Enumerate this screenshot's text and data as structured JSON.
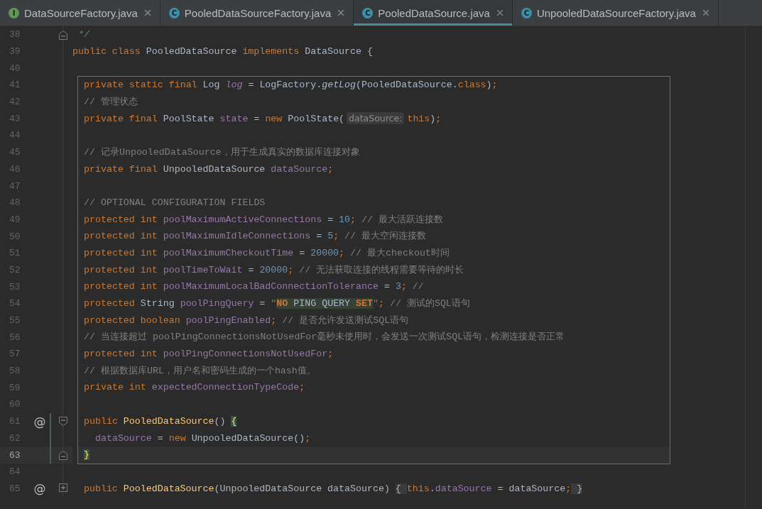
{
  "tabs": [
    {
      "label": "DataSourceFactory.java",
      "icon_letter": "I",
      "color": "#629755",
      "selected": false
    },
    {
      "label": "PooledDataSourceFactory.java",
      "icon_letter": "C",
      "color": "#3d8ea8",
      "selected": false
    },
    {
      "label": "PooledDataSource.java",
      "icon_letter": "C",
      "color": "#3d8ea8",
      "selected": true
    },
    {
      "label": "UnpooledDataSourceFactory.java",
      "icon_letter": "C",
      "color": "#3d8ea8",
      "selected": false
    }
  ],
  "editor": {
    "lines": [
      {
        "number": "38",
        "fold": {
          "kind": "end"
        },
        "boxed": false,
        "current": false,
        "changed": false,
        "tokens": [
          {
            "t": " */",
            "kind": "doc"
          }
        ]
      },
      {
        "number": "39",
        "boxed": false,
        "current": false,
        "changed": false,
        "tokens": [
          {
            "t": "public class ",
            "kind": "kw"
          },
          {
            "t": "PooledDataSource ",
            "kind": "plain"
          },
          {
            "t": "implements ",
            "kind": "kw"
          },
          {
            "t": "DataSource {",
            "kind": "plain"
          }
        ]
      },
      {
        "number": "40",
        "boxed": false,
        "current": false,
        "changed": false
      },
      {
        "number": "41",
        "boxed": true,
        "current": false,
        "changed": false,
        "tokens": [
          {
            "t": "private static final ",
            "kind": "kw"
          },
          {
            "t": "Log ",
            "kind": "plain"
          },
          {
            "t": "log",
            "kind": "static"
          },
          {
            "t": " = LogFactory.",
            "kind": "plain"
          },
          {
            "t": "getLog",
            "kind": "call"
          },
          {
            "t": "(PooledDataSource.",
            "kind": "plain"
          },
          {
            "t": "class",
            "kind": "kw"
          },
          {
            "t": ")",
            "kind": "plain"
          },
          {
            "t": ";",
            "kind": "kw"
          }
        ]
      },
      {
        "number": "42",
        "boxed": true,
        "current": false,
        "changed": false,
        "tokens": [
          {
            "t": "// 管理状态",
            "kind": "comment"
          }
        ]
      },
      {
        "number": "43",
        "boxed": true,
        "current": false,
        "changed": false,
        "tokens": [
          {
            "t": "private final ",
            "kind": "kw"
          },
          {
            "t": "PoolState ",
            "kind": "plain"
          },
          {
            "t": "state",
            "kind": "field"
          },
          {
            "t": " = ",
            "kind": "plain"
          },
          {
            "t": "new ",
            "kind": "kw"
          },
          {
            "t": "PoolState(",
            "kind": "plain"
          },
          {
            "t": "dataSource:",
            "kind": "hint"
          },
          {
            "t": "this",
            "kind": "kw"
          },
          {
            "t": ")",
            "kind": "plain"
          },
          {
            "t": ";",
            "kind": "kw"
          }
        ]
      },
      {
        "number": "44",
        "boxed": true,
        "current": false,
        "changed": false
      },
      {
        "number": "45",
        "boxed": true,
        "current": false,
        "changed": false,
        "tokens": [
          {
            "t": "// 记录UnpooledDataSource，用于生成真实的数据库连接对象",
            "kind": "comment"
          }
        ]
      },
      {
        "number": "46",
        "boxed": true,
        "current": false,
        "changed": false,
        "tokens": [
          {
            "t": "private final ",
            "kind": "kw"
          },
          {
            "t": "UnpooledDataSource ",
            "kind": "plain"
          },
          {
            "t": "dataSource",
            "kind": "field"
          },
          {
            "t": ";",
            "kind": "kw"
          }
        ]
      },
      {
        "number": "47",
        "boxed": true,
        "current": false,
        "changed": false
      },
      {
        "number": "48",
        "boxed": true,
        "current": false,
        "changed": false,
        "tokens": [
          {
            "t": "// OPTIONAL CONFIGURATION FIELDS",
            "kind": "comment"
          }
        ]
      },
      {
        "number": "49",
        "boxed": true,
        "current": false,
        "changed": false,
        "tokens": [
          {
            "t": "protected int ",
            "kind": "kw"
          },
          {
            "t": "poolMaximumActiveConnections",
            "kind": "field"
          },
          {
            "t": " = ",
            "kind": "plain"
          },
          {
            "t": "10",
            "kind": "num"
          },
          {
            "t": ";",
            "kind": "kw"
          },
          {
            "t": " // 最大活跃连接数",
            "kind": "comment"
          }
        ]
      },
      {
        "number": "50",
        "boxed": true,
        "current": false,
        "changed": false,
        "tokens": [
          {
            "t": "protected int ",
            "kind": "kw"
          },
          {
            "t": "poolMaximumIdleConnections",
            "kind": "field"
          },
          {
            "t": " = ",
            "kind": "plain"
          },
          {
            "t": "5",
            "kind": "num"
          },
          {
            "t": ";",
            "kind": "kw"
          },
          {
            "t": " // 最大空闲连接数",
            "kind": "comment"
          }
        ]
      },
      {
        "number": "51",
        "boxed": true,
        "current": false,
        "changed": false,
        "tokens": [
          {
            "t": "protected int ",
            "kind": "kw"
          },
          {
            "t": "poolMaximumCheckoutTime",
            "kind": "field"
          },
          {
            "t": " = ",
            "kind": "plain"
          },
          {
            "t": "20000",
            "kind": "num"
          },
          {
            "t": ";",
            "kind": "kw"
          },
          {
            "t": " // 最大checkout时间",
            "kind": "comment"
          }
        ]
      },
      {
        "number": "52",
        "boxed": true,
        "current": false,
        "changed": false,
        "tokens": [
          {
            "t": "protected int ",
            "kind": "kw"
          },
          {
            "t": "poolTimeToWait",
            "kind": "field"
          },
          {
            "t": " = ",
            "kind": "plain"
          },
          {
            "t": "20000",
            "kind": "num"
          },
          {
            "t": ";",
            "kind": "kw"
          },
          {
            "t": " // 无法获取连接的线程需要等待的时长",
            "kind": "comment"
          }
        ]
      },
      {
        "number": "53",
        "boxed": true,
        "current": false,
        "changed": false,
        "tokens": [
          {
            "t": "protected int ",
            "kind": "kw"
          },
          {
            "t": "poolMaximumLocalBadConnectionTolerance",
            "kind": "field"
          },
          {
            "t": " = ",
            "kind": "plain"
          },
          {
            "t": "3",
            "kind": "num"
          },
          {
            "t": ";",
            "kind": "kw"
          },
          {
            "t": " //",
            "kind": "comment"
          }
        ]
      },
      {
        "number": "54",
        "boxed": true,
        "current": false,
        "changed": false,
        "tokens": [
          {
            "t": "protected ",
            "kind": "kw"
          },
          {
            "t": "String ",
            "kind": "plain"
          },
          {
            "t": "poolPingQuery",
            "kind": "field"
          },
          {
            "t": " = ",
            "kind": "plain"
          },
          {
            "t": "\"",
            "kind": "str"
          },
          {
            "t": "NO",
            "kind": "sqlkw"
          },
          {
            "t": " PING QUERY ",
            "kind": "sql"
          },
          {
            "t": "SET",
            "kind": "sqlkw"
          },
          {
            "t": "\"",
            "kind": "str"
          },
          {
            "t": ";",
            "kind": "kw"
          },
          {
            "t": " // 测试的SQL语句",
            "kind": "comment"
          }
        ]
      },
      {
        "number": "55",
        "boxed": true,
        "current": false,
        "changed": false,
        "tokens": [
          {
            "t": "protected boolean ",
            "kind": "kw"
          },
          {
            "t": "poolPingEnabled",
            "kind": "field"
          },
          {
            "t": ";",
            "kind": "kw"
          },
          {
            "t": " // 是否允许发送测试SQL语句",
            "kind": "comment"
          }
        ]
      },
      {
        "number": "56",
        "boxed": true,
        "current": false,
        "changed": false,
        "tokens": [
          {
            "t": "// 当连接超过 poolPingConnectionsNotUsedFor毫秒未使用时，会发送一次测试SQL语句，检测连接是否正常",
            "kind": "comment"
          }
        ]
      },
      {
        "number": "57",
        "boxed": true,
        "current": false,
        "changed": false,
        "tokens": [
          {
            "t": "protected int ",
            "kind": "kw"
          },
          {
            "t": "poolPingConnectionsNotUsedFor",
            "kind": "field"
          },
          {
            "t": ";",
            "kind": "kw"
          }
        ]
      },
      {
        "number": "58",
        "boxed": true,
        "current": false,
        "changed": false,
        "tokens": [
          {
            "t": "// 根据数据库URL，用户名和密码生成的一个hash值。",
            "kind": "comment"
          }
        ]
      },
      {
        "number": "59",
        "boxed": true,
        "current": false,
        "changed": false,
        "tokens": [
          {
            "t": "private int ",
            "kind": "kw"
          },
          {
            "t": "expectedConnectionTypeCode",
            "kind": "field"
          },
          {
            "t": ";",
            "kind": "kw"
          }
        ]
      },
      {
        "number": "60",
        "boxed": true,
        "current": false,
        "changed": false
      },
      {
        "number": "61",
        "marker": "@",
        "fold": {
          "kind": "start"
        },
        "boxed": true,
        "current": false,
        "changed": true,
        "tokens": [
          {
            "t": "public ",
            "kind": "kw"
          },
          {
            "t": "PooledDataSource",
            "kind": "decl"
          },
          {
            "t": "() ",
            "kind": "plain"
          },
          {
            "t": "{",
            "kind": "brace"
          }
        ]
      },
      {
        "number": "62",
        "boxed": true,
        "current": false,
        "changed": true,
        "tokens": [
          {
            "t": "  dataSource",
            "kind": "field"
          },
          {
            "t": " = ",
            "kind": "plain"
          },
          {
            "t": "new ",
            "kind": "kw"
          },
          {
            "t": "UnpooledDataSource()",
            "kind": "plain"
          },
          {
            "t": ";",
            "kind": "kw"
          }
        ]
      },
      {
        "number": "63",
        "fold": {
          "kind": "end"
        },
        "boxed": true,
        "current": true,
        "changed": true,
        "tokens": [
          {
            "t": "}",
            "kind": "brace"
          }
        ]
      },
      {
        "number": "64",
        "boxed": false,
        "current": false,
        "changed": false
      },
      {
        "number": "65",
        "marker": "@",
        "fold": {
          "kind": "expand"
        },
        "boxed": false,
        "current": false,
        "changed": false,
        "tokens": [
          {
            "t": "  public ",
            "kind": "kw"
          },
          {
            "t": "PooledDataSource",
            "kind": "decl"
          },
          {
            "t": "(UnpooledDataSource dataSource) ",
            "kind": "plain"
          },
          {
            "t": "{ ",
            "kind": "folded"
          },
          {
            "t": "this",
            "kind": "kw"
          },
          {
            "t": ".",
            "kind": "plain"
          },
          {
            "t": "dataSource",
            "kind": "field"
          },
          {
            "t": " = dataSource",
            "kind": "plain"
          },
          {
            "t": ";",
            "kind": "kw"
          },
          {
            "t": " }",
            "kind": "folded"
          }
        ]
      }
    ]
  }
}
